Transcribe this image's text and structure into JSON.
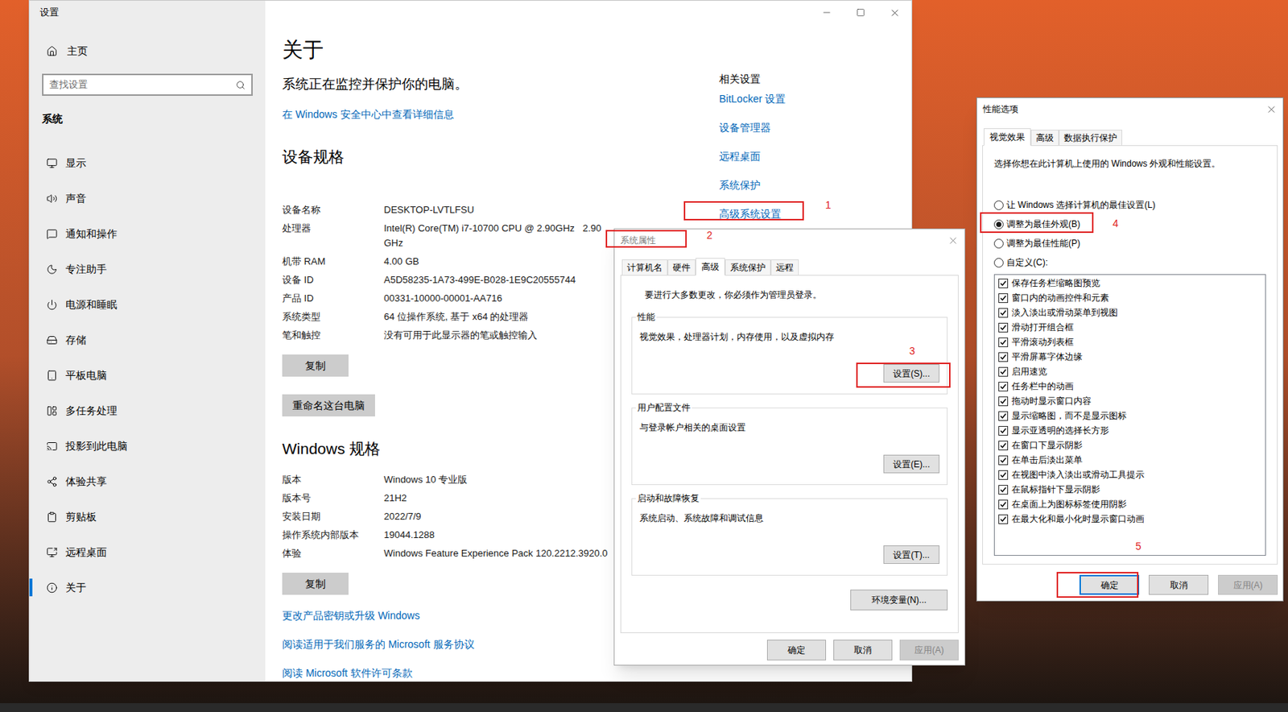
{
  "settings_window": {
    "title": "设置"
  },
  "sidebar": {
    "home": "主页",
    "search": {
      "placeholder": "查找设置"
    },
    "section": "系统",
    "items": [
      {
        "label": "显示",
        "selected": false
      },
      {
        "label": "声音",
        "selected": false
      },
      {
        "label": "通知和操作",
        "selected": false
      },
      {
        "label": "专注助手",
        "selected": false
      },
      {
        "label": "电源和睡眠",
        "selected": false
      },
      {
        "label": "存储",
        "selected": false
      },
      {
        "label": "平板电脑",
        "selected": false
      },
      {
        "label": "多任务处理",
        "selected": false
      },
      {
        "label": "投影到此电脑",
        "selected": false
      },
      {
        "label": "体验共享",
        "selected": false
      },
      {
        "label": "剪贴板",
        "selected": false
      },
      {
        "label": "远程桌面",
        "selected": false
      },
      {
        "label": "关于",
        "selected": true
      }
    ]
  },
  "about": {
    "title": "关于",
    "status": "系统正在监控并保护你的电脑。",
    "security_link": "在 Windows 安全中心中查看详细信息",
    "device_heading": "设备规格",
    "device_specs": [
      {
        "label": "设备名称",
        "value": "DESKTOP-LVTLFSU"
      },
      {
        "label": "处理器",
        "value": "Intel(R) Core(TM) i7-10700 CPU @ 2.90GHz   2.90 GHz"
      },
      {
        "label": "机带 RAM",
        "value": "4.00 GB"
      },
      {
        "label": "设备 ID",
        "value": "A5D58235-1A73-499E-B028-1E9C20555744"
      },
      {
        "label": "产品 ID",
        "value": "00331-10000-00001-AA716"
      },
      {
        "label": "系统类型",
        "value": "64 位操作系统, 基于 x64 的处理器"
      },
      {
        "label": "笔和触控",
        "value": "没有可用于此显示器的笔或触控输入"
      }
    ],
    "copy_button": "复制",
    "rename_button": "重命名这台电脑",
    "windows_heading": "Windows 规格",
    "windows_specs": [
      {
        "label": "版本",
        "value": "Windows 10 专业版"
      },
      {
        "label": "版本号",
        "value": "21H2"
      },
      {
        "label": "安装日期",
        "value": "2022/7/9"
      },
      {
        "label": "操作系统内部版本",
        "value": "19044.1288"
      },
      {
        "label": "体验",
        "value": "Windows Feature Experience Pack 120.2212.3920.0"
      }
    ],
    "windows_copy_button": "复制",
    "links": [
      "更改产品密钥或升级 Windows",
      "阅读适用于我们服务的 Microsoft 服务协议",
      "阅读 Microsoft 软件许可条款"
    ]
  },
  "related": {
    "heading": "相关设置",
    "links": [
      "BitLocker 设置",
      "设备管理器",
      "远程桌面",
      "系统保护",
      "高级系统设置"
    ]
  },
  "system_properties": {
    "title": "系统属性",
    "tabs": [
      {
        "label": "计算机名",
        "selected": false
      },
      {
        "label": "硬件",
        "selected": false
      },
      {
        "label": "高级",
        "selected": true
      },
      {
        "label": "系统保护",
        "selected": false
      },
      {
        "label": "远程",
        "selected": false
      }
    ],
    "admin_note": "要进行大多数更改，你必须作为管理员登录。",
    "groups": [
      {
        "title": "性能",
        "description": "视觉效果，处理器计划，内存使用，以及虚拟内存",
        "button": "设置(S)..."
      },
      {
        "title": "用户配置文件",
        "description": "与登录帐户相关的桌面设置",
        "button": "设置(E)..."
      },
      {
        "title": "启动和故障恢复",
        "description": "系统启动、系统故障和调试信息",
        "button": "设置(T)..."
      }
    ],
    "env_button": "环境变量(N)...",
    "buttons": [
      {
        "label": "确定",
        "disabled": false
      },
      {
        "label": "取消",
        "disabled": false
      },
      {
        "label": "应用(A)",
        "disabled": true
      }
    ]
  },
  "performance_options": {
    "title": "性能选项",
    "tabs": [
      {
        "label": "视觉效果",
        "selected": true
      },
      {
        "label": "高级",
        "selected": false
      },
      {
        "label": "数据执行保护",
        "selected": false
      }
    ],
    "description": "选择你想在此计算机上使用的 Windows 外观和性能设置。",
    "options": [
      {
        "label": "让 Windows 选择计算机的最佳设置(L)",
        "selected": false
      },
      {
        "label": "调整为最佳外观(B)",
        "selected": true
      },
      {
        "label": "调整为最佳性能(P)",
        "selected": false
      },
      {
        "label": "自定义(C):",
        "selected": false
      }
    ],
    "effects": [
      {
        "label": "保存任务栏缩略图预览",
        "checked": true
      },
      {
        "label": "窗口内的动画控件和元素",
        "checked": true
      },
      {
        "label": "淡入淡出或滑动菜单到视图",
        "checked": true
      },
      {
        "label": "滑动打开组合框",
        "checked": true
      },
      {
        "label": "平滑滚动列表框",
        "checked": true
      },
      {
        "label": "平滑屏幕字体边缘",
        "checked": true
      },
      {
        "label": "启用速览",
        "checked": true
      },
      {
        "label": "任务栏中的动画",
        "checked": true
      },
      {
        "label": "拖动时显示窗口内容",
        "checked": true
      },
      {
        "label": "显示缩略图，而不是显示图标",
        "checked": true
      },
      {
        "label": "显示亚透明的选择长方形",
        "checked": true
      },
      {
        "label": "在窗口下显示阴影",
        "checked": true
      },
      {
        "label": "在单击后淡出菜单",
        "checked": true
      },
      {
        "label": "在视图中淡入淡出或滑动工具提示",
        "checked": true
      },
      {
        "label": "在鼠标指针下显示阴影",
        "checked": true
      },
      {
        "label": "在桌面上为图标标签使用阴影",
        "checked": true
      },
      {
        "label": "在最大化和最小化时显示窗口动画",
        "checked": true
      }
    ],
    "buttons": [
      {
        "label": "确定",
        "disabled": false,
        "focused": true
      },
      {
        "label": "取消",
        "disabled": false,
        "focused": false
      },
      {
        "label": "应用(A)",
        "disabled": true,
        "focused": false
      }
    ]
  },
  "annotations": [
    {
      "number": "1"
    },
    {
      "number": "2"
    },
    {
      "number": "3"
    },
    {
      "number": "4"
    },
    {
      "number": "5"
    }
  ]
}
